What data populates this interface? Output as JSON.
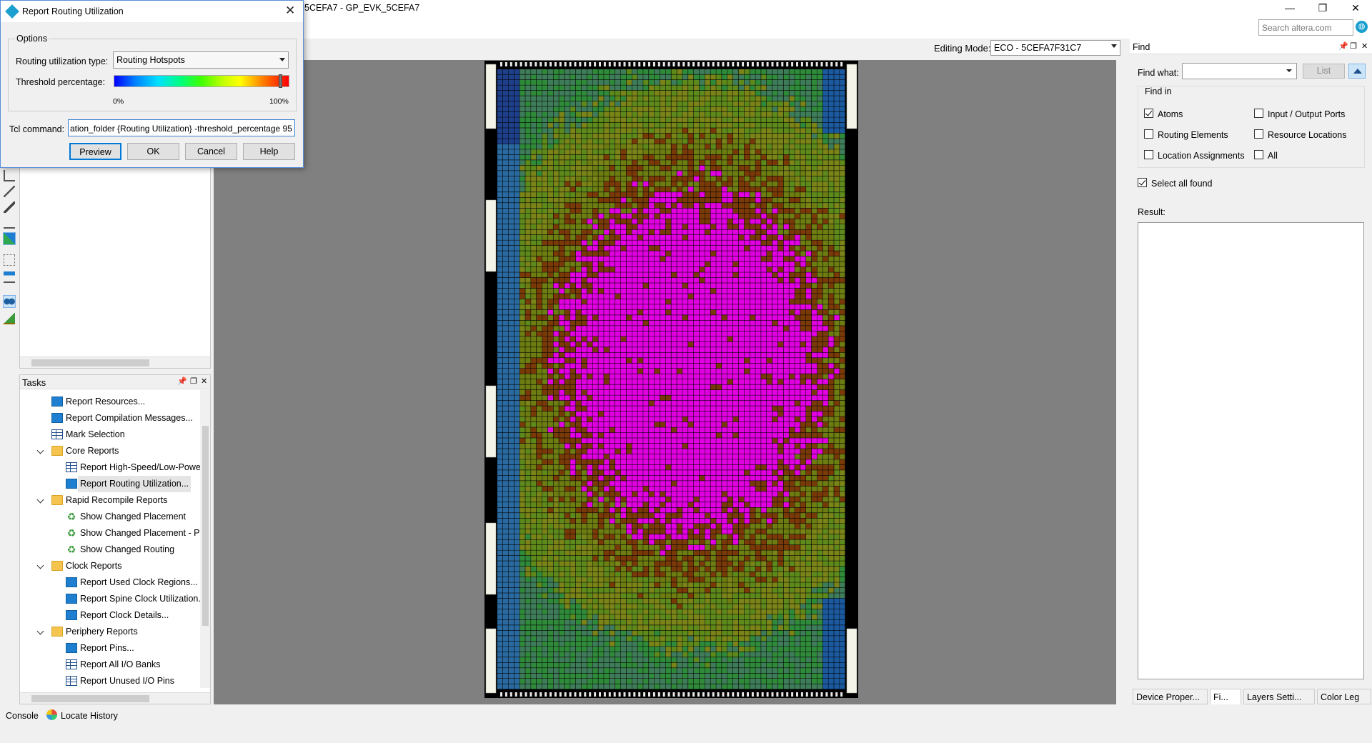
{
  "window": {
    "title": "5CEFA7 - GP_EVK_5CEFA7",
    "search_placeholder": "Search altera.com"
  },
  "editing_mode": {
    "label": "Editing Mode:",
    "value": "ECO - 5CEFA7F31C7"
  },
  "dialog": {
    "title": "Report Routing Utilization",
    "options_title": "Options",
    "routing_type_label": "Routing utilization type:",
    "routing_type_value": "Routing Hotspots",
    "threshold_label": "Threshold percentage:",
    "threshold_min": "0%",
    "threshold_max": "100%",
    "threshold_value_percent": 95,
    "tcl_label": "Tcl command:",
    "tcl_value": "ation_folder {Routing Utilization} -threshold_percentage 95",
    "buttons": {
      "preview": "Preview",
      "ok": "OK",
      "cancel": "Cancel",
      "help": "Help"
    }
  },
  "tasks": {
    "title": "Tasks",
    "items": [
      {
        "label": "Report Resources...",
        "icon": "report-icon",
        "level": 1
      },
      {
        "label": "Report Compilation Messages...",
        "icon": "report-icon",
        "level": 1
      },
      {
        "label": "Mark Selection",
        "icon": "table-icon",
        "level": 1
      },
      {
        "label": "Core Reports",
        "icon": "folder-icon",
        "level": 0
      },
      {
        "label": "Report High-Speed/Low-Power",
        "icon": "table-icon",
        "level": 2
      },
      {
        "label": "Report Routing Utilization...",
        "icon": "report-icon",
        "level": 2,
        "selected": true
      },
      {
        "label": "Rapid Recompile Reports",
        "icon": "folder-icon",
        "level": 0
      },
      {
        "label": "Show Changed Placement",
        "icon": "recycle-icon",
        "level": 2
      },
      {
        "label": "Show Changed Placement - Pa",
        "icon": "recycle-icon",
        "level": 2
      },
      {
        "label": "Show Changed Routing",
        "icon": "recycle-icon",
        "level": 2
      },
      {
        "label": "Clock Reports",
        "icon": "folder-icon",
        "level": 0
      },
      {
        "label": "Report Used Clock Regions...",
        "icon": "report-icon",
        "level": 2
      },
      {
        "label": "Report Spine Clock Utilization...",
        "icon": "report-icon",
        "level": 2
      },
      {
        "label": "Report Clock Details...",
        "icon": "report-icon",
        "level": 2
      },
      {
        "label": "Periphery Reports",
        "icon": "folder-icon",
        "level": 0
      },
      {
        "label": "Report Pins...",
        "icon": "report-icon",
        "level": 2
      },
      {
        "label": "Report All I/O Banks",
        "icon": "table-icon",
        "level": 2
      },
      {
        "label": "Report Unused I/O Pins",
        "icon": "table-icon",
        "level": 2
      }
    ]
  },
  "find": {
    "title": "Find",
    "find_what_label": "Find what:",
    "list_button": "List",
    "find_in_title": "Find in",
    "options": {
      "atoms": "Atoms",
      "io_ports": "Input / Output Ports",
      "routing_elements": "Routing Elements",
      "resource_locations": "Resource Locations",
      "location_assignments": "Location Assignments",
      "all": "All"
    },
    "atoms_checked": true,
    "select_all_found": "Select all found",
    "select_all_found_checked": true,
    "result_label": "Result:"
  },
  "bottom_tabs": [
    "Device Proper...",
    "Fi...",
    "Layers Setti...",
    "Color Leg"
  ],
  "status_tabs": {
    "console": "Console",
    "locate_history": "Locate History"
  },
  "colors": {
    "hotspot": "#e000e0",
    "hot_cell": "#7a3a08",
    "accent": "#0078d7"
  }
}
